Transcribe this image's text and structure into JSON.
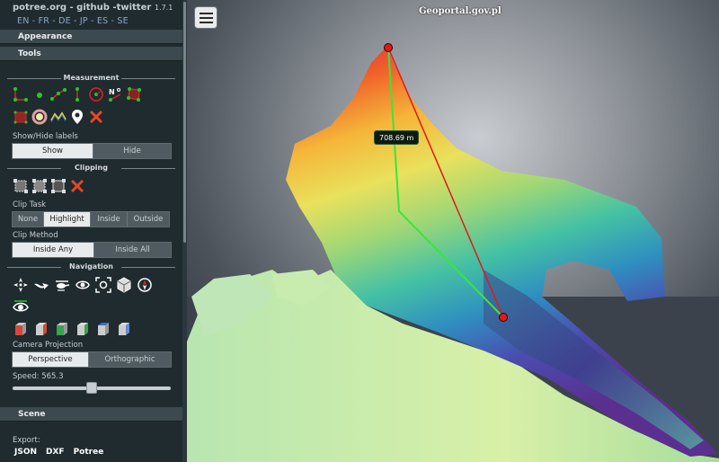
{
  "header": {
    "links": "potree.org - github -twitter",
    "version": "1.7.1",
    "languages": "EN - FR - DE - JP - ES - SE"
  },
  "sections": {
    "appearance": "Appearance",
    "tools": "Tools",
    "scene": "Scene"
  },
  "measurement": {
    "title": "Measurement",
    "tools": [
      "angle-icon",
      "point-icon",
      "distance-icon",
      "height-icon",
      "circle-icon",
      "azimuth-icon",
      "area-icon",
      "volume-icon",
      "sphere-volume-icon",
      "profile-icon",
      "annotation-icon",
      "remove-all-icon"
    ],
    "labels_title": "Show/Hide labels",
    "show": "Show",
    "hide": "Hide"
  },
  "clipping": {
    "title": "Clipping",
    "clip_task_label": "Clip Task",
    "clip_task_options": [
      "None",
      "Highlight",
      "Inside",
      "Outside"
    ],
    "clip_task_active": "Highlight",
    "clip_method_label": "Clip Method",
    "clip_method_options": [
      "Inside Any",
      "Inside All"
    ],
    "clip_method_active": "Inside Any"
  },
  "navigation": {
    "title": "Navigation",
    "camera_projection_label": "Camera Projection",
    "projection_options": [
      "Perspective",
      "Orthographic"
    ],
    "projection_active": "Perspective",
    "speed_label": "Speed: 565.3",
    "speed_fraction": 0.5
  },
  "export": {
    "label": "Export:",
    "formats": [
      "JSON",
      "DXF",
      "Potree"
    ]
  },
  "viewport": {
    "attribution": "Geoportal.gov.pl",
    "distance_label": "708.69 m"
  }
}
